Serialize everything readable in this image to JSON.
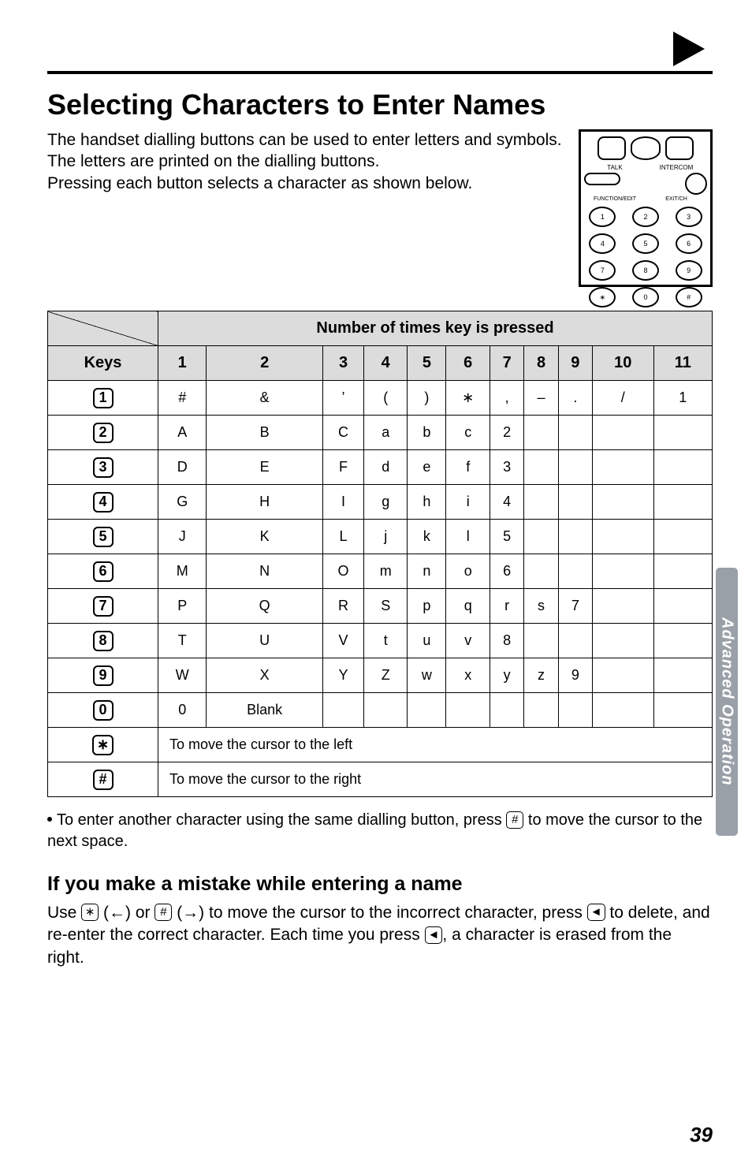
{
  "page_number": "39",
  "side_tab": "Advanced Operation",
  "title": "Selecting Characters to Enter Names",
  "intro_p1": "The handset dialling buttons can be used to enter letters and symbols. The letters are printed on the dialling buttons.",
  "intro_p2": "Pressing each button selects a character as shown below.",
  "chart_data": {
    "type": "table",
    "title": "Number of times key is pressed",
    "row_header": "Keys",
    "columns": [
      "1",
      "2",
      "3",
      "4",
      "5",
      "6",
      "7",
      "8",
      "9",
      "10",
      "11"
    ],
    "rows": [
      {
        "key": "1",
        "cells": [
          "#",
          "&",
          "’",
          "(",
          ")",
          "∗",
          ",",
          "–",
          ".",
          "/",
          "1"
        ]
      },
      {
        "key": "2",
        "cells": [
          "A",
          "B",
          "C",
          "a",
          "b",
          "c",
          "2",
          "",
          "",
          "",
          ""
        ]
      },
      {
        "key": "3",
        "cells": [
          "D",
          "E",
          "F",
          "d",
          "e",
          "f",
          "3",
          "",
          "",
          "",
          ""
        ]
      },
      {
        "key": "4",
        "cells": [
          "G",
          "H",
          "I",
          "g",
          "h",
          "i",
          "4",
          "",
          "",
          "",
          ""
        ]
      },
      {
        "key": "5",
        "cells": [
          "J",
          "K",
          "L",
          "j",
          "k",
          "l",
          "5",
          "",
          "",
          "",
          ""
        ]
      },
      {
        "key": "6",
        "cells": [
          "M",
          "N",
          "O",
          "m",
          "n",
          "o",
          "6",
          "",
          "",
          "",
          ""
        ]
      },
      {
        "key": "7",
        "cells": [
          "P",
          "Q",
          "R",
          "S",
          "p",
          "q",
          "r",
          "s",
          "7",
          "",
          ""
        ]
      },
      {
        "key": "8",
        "cells": [
          "T",
          "U",
          "V",
          "t",
          "u",
          "v",
          "8",
          "",
          "",
          "",
          ""
        ]
      },
      {
        "key": "9",
        "cells": [
          "W",
          "X",
          "Y",
          "Z",
          "w",
          "x",
          "y",
          "z",
          "9",
          "",
          ""
        ]
      },
      {
        "key": "0",
        "cells": [
          "0",
          "Blank",
          "",
          "",
          "",
          "",
          "",
          "",
          "",
          "",
          ""
        ]
      }
    ],
    "star_row": "To move the cursor to the left",
    "hash_row": "To move the cursor to the right"
  },
  "note": {
    "pre": "To enter another character using the same dialling button, press ",
    "key": "#",
    "post": " to move the cursor to the next space."
  },
  "subheading": "If you make a mistake while entering a name",
  "mistake": {
    "t1": "Use ",
    "k_star": "∗",
    "t2": " (←) or ",
    "k_hash": "#",
    "t3": " (→) to move the cursor to the incorrect character, press ",
    "k_left1": "◄",
    "t4": " to delete, and re-enter the correct character. Each time you press ",
    "k_left2": "◄",
    "t5": ", a character is erased from the right."
  },
  "handset_labels": {
    "talk": "TALK",
    "intercom": "INTERCOM",
    "func": "FUNCTION/EDIT",
    "exit": "EXIT/CH"
  },
  "keypad": [
    "1",
    "2",
    "3",
    "4",
    "5",
    "6",
    "7",
    "8",
    "9",
    "∗",
    "0",
    "#"
  ]
}
